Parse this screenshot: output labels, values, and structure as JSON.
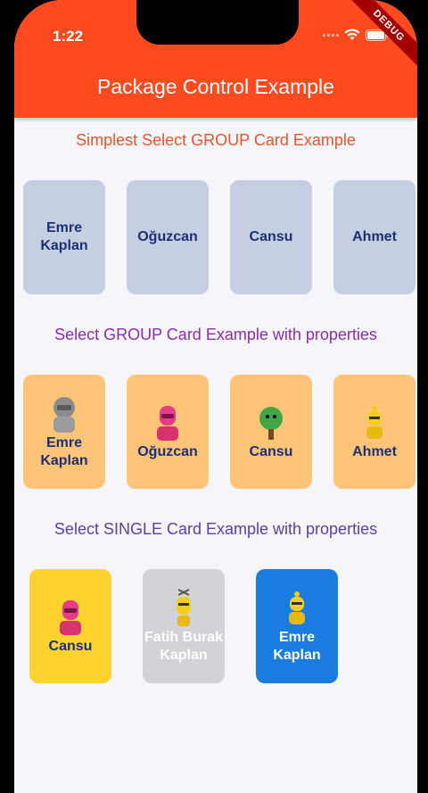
{
  "status": {
    "time": "1:22",
    "debug_label": "DEBUG"
  },
  "appbar": {
    "title": "Package Control Example"
  },
  "sections": [
    {
      "title": "Simplest Select GROUP Card Example",
      "color": "#e8542c"
    },
    {
      "title": "Select GROUP Card Example with properties",
      "color": "#8a2db0"
    },
    {
      "title": "Select SINGLE Card Example with properties",
      "color": "#5a3fa6"
    }
  ],
  "group_simple": [
    {
      "name": "Emre\nKaplan"
    },
    {
      "name": "Oğuzcan"
    },
    {
      "name": "Cansu"
    },
    {
      "name": "Ahmet"
    }
  ],
  "group_props": [
    {
      "name": "Emre\nKaplan",
      "icon": "grey-robot-icon"
    },
    {
      "name": "Oğuzcan",
      "icon": "pink-robot-icon"
    },
    {
      "name": "Cansu",
      "icon": "green-tree-robot-icon"
    },
    {
      "name": "Ahmet",
      "icon": "yellow-robot-icon"
    }
  ],
  "single": [
    {
      "name": "Cansu",
      "icon": "pink-robot-icon",
      "state": "selected"
    },
    {
      "name": "Fatih Burak\nKaplan",
      "icon": "antenna-robot-icon",
      "state": "disabled"
    },
    {
      "name": "Emre\nKaplan",
      "icon": "yellow-robot-icon",
      "state": "active"
    }
  ],
  "colors": {
    "appbar": "#fe4a1e",
    "card_plain": "#c5cfe1",
    "card_orange": "#fec478",
    "card_yellow": "#fed22f",
    "card_grey": "#d3d2d6",
    "card_blue": "#1a7ce0"
  }
}
